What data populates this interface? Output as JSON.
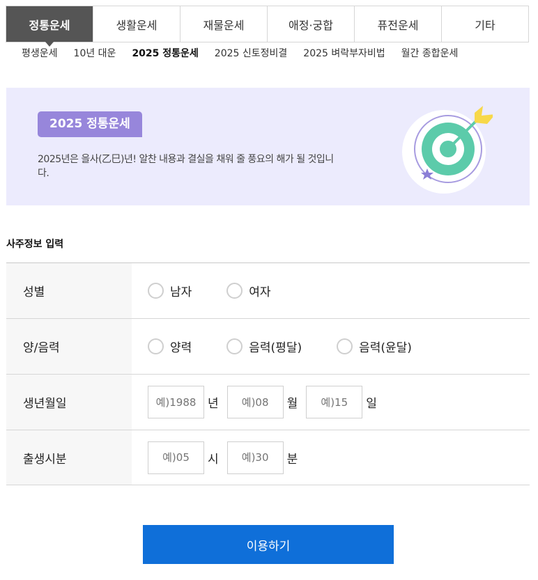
{
  "tabs": [
    {
      "label": "정통운세",
      "active": true
    },
    {
      "label": "생활운세",
      "active": false
    },
    {
      "label": "재물운세",
      "active": false
    },
    {
      "label": "애정·궁합",
      "active": false
    },
    {
      "label": "퓨전운세",
      "active": false
    },
    {
      "label": "기타",
      "active": false
    }
  ],
  "subnav": [
    {
      "label": "평생운세",
      "active": false
    },
    {
      "label": "10년 대운",
      "active": false
    },
    {
      "label": "2025 정통운세",
      "active": true
    },
    {
      "label": "2025 신토정비결",
      "active": false
    },
    {
      "label": "2025 벼락부자비법",
      "active": false
    },
    {
      "label": "월간 종합운세",
      "active": false
    }
  ],
  "banner": {
    "badge": "2025 정통운세",
    "description": "2025년은 을사(乙巳)년! 알찬 내용과 결실을 채워 줄 풍요의 해가 될 것입니다.",
    "icon": "target-arrow-icon",
    "colors": {
      "background": "#ecebfd",
      "badge": "#9786db",
      "target": "#5ccbaa",
      "arrow_tip": "#f7d84a"
    }
  },
  "form": {
    "section_title": "사주정보 입력",
    "gender": {
      "label": "성별",
      "options": [
        "남자",
        "여자"
      ]
    },
    "calendar": {
      "label": "양/음력",
      "options": [
        "양력",
        "음력(평달)",
        "음력(윤달)"
      ]
    },
    "birthdate": {
      "label": "생년월일",
      "year_placeholder": "예)1988",
      "year_unit": "년",
      "month_placeholder": "예)08",
      "month_unit": "월",
      "day_placeholder": "예)15",
      "day_unit": "일"
    },
    "birthtime": {
      "label": "출생시분",
      "hour_placeholder": "예)05",
      "hour_unit": "시",
      "minute_placeholder": "예)30",
      "minute_unit": "분"
    }
  },
  "submit_label": "이용하기",
  "colors": {
    "tab_active": "#555555",
    "submit": "#0f6fd9"
  }
}
